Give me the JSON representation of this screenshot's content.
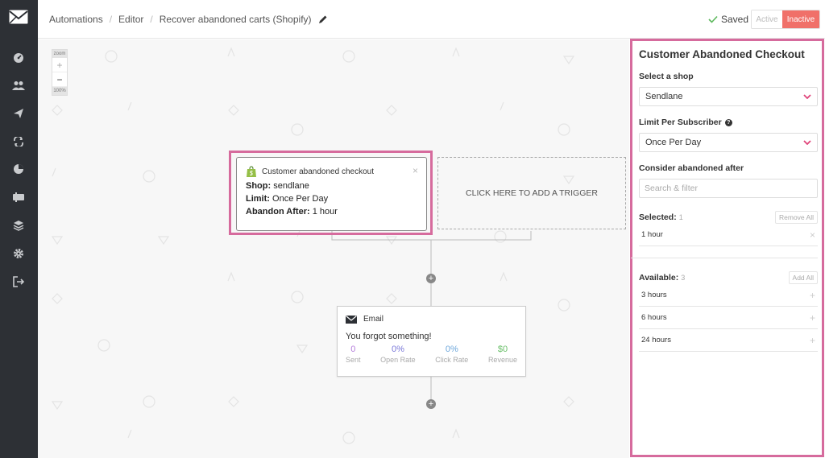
{
  "header": {
    "breadcrumbs": [
      "Automations",
      "Editor",
      "Recover abandoned carts (Shopify)"
    ],
    "saved_label": "Saved",
    "status_active": "Active",
    "status_inactive": "Inactive"
  },
  "zoom": {
    "label": "zoom",
    "plus": "+",
    "minus": "−",
    "level": "100%"
  },
  "trigger": {
    "title": "Customer abandoned checkout",
    "close": "×",
    "shop_label": "Shop:",
    "shop_value": "sendlane",
    "limit_label": "Limit:",
    "limit_value": "Once Per Day",
    "abandon_label": "Abandon After:",
    "abandon_value": "1 hour"
  },
  "add_trigger_label": "CLICK HERE TO ADD A TRIGGER",
  "email": {
    "title": "Email",
    "subject": "You forgot something!",
    "stats": [
      {
        "value": "0",
        "label": "Sent",
        "color": "#b57edc"
      },
      {
        "value": "0%",
        "label": "Open Rate",
        "color": "#7b79d9"
      },
      {
        "value": "0%",
        "label": "Click Rate",
        "color": "#6fa8dc"
      },
      {
        "value": "$0",
        "label": "Revenue",
        "color": "#6abf69"
      }
    ]
  },
  "panel": {
    "title": "Customer Abandoned Checkout",
    "shop_label": "Select a shop",
    "shop_value": "Sendlane",
    "limit_label": "Limit Per Subscriber",
    "limit_help": "?",
    "limit_value": "Once Per Day",
    "abandon_label": "Consider abandoned after",
    "search_placeholder": "Search & filter",
    "selected_label": "Selected:",
    "selected_count": "1",
    "remove_all": "Remove All",
    "selected_items": [
      "1 hour"
    ],
    "available_label": "Available:",
    "available_count": "3",
    "add_all": "Add All",
    "available_items": [
      "3 hours",
      "6 hours",
      "24 hours"
    ]
  },
  "colors": {
    "accent_pink": "#d66b9d",
    "inactive_red": "#f07069",
    "sidebar_bg": "#2d3035",
    "chevron": "#e0457b"
  }
}
